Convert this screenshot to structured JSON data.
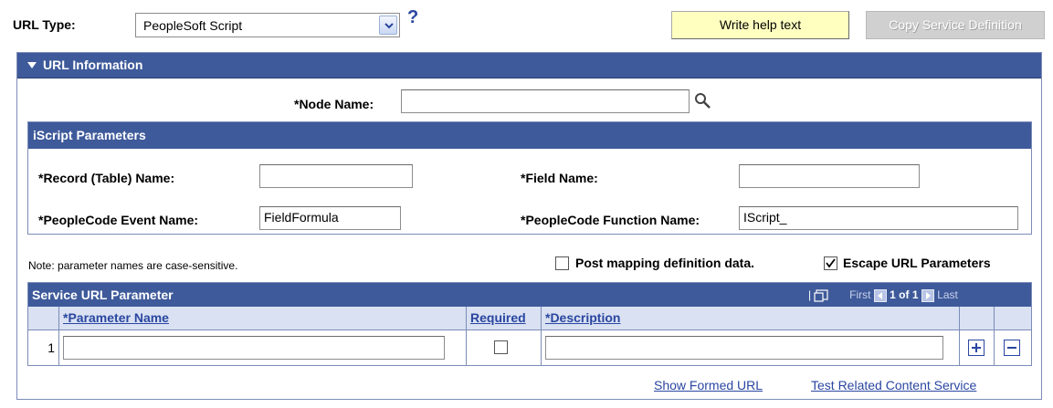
{
  "top": {
    "url_type_label": "URL Type:",
    "url_type_value": "PeopleSoft Script",
    "help_mark": "?",
    "write_help_label": "Write help text",
    "copy_service_label": "Copy Service Definition"
  },
  "url_info": {
    "title": "URL Information",
    "node_name_label": "*Node Name:",
    "node_name_value": ""
  },
  "iscript": {
    "title": "iScript Parameters",
    "record_label": "*Record (Table) Name:",
    "record_value": "",
    "field_label": "*Field Name:",
    "field_value": "",
    "event_label": "*PeopleCode Event Name:",
    "event_value": "FieldFormula",
    "function_label": "*PeopleCode Function Name:",
    "function_value": "IScript_"
  },
  "options": {
    "note": "Note: parameter names are case-sensitive.",
    "post_mapping_label": "Post mapping definition data.",
    "post_mapping_checked": false,
    "escape_label": "Escape URL Parameters",
    "escape_checked": true
  },
  "grid": {
    "title": "Service URL Parameter",
    "nav_first": "First",
    "nav_count": "1 of 1",
    "nav_last": "Last",
    "columns": [
      "*Parameter Name",
      "Required",
      "*Description"
    ],
    "rows": [
      {
        "num": "1",
        "parameter_name": "",
        "required": false,
        "description": ""
      }
    ]
  },
  "footer": {
    "show_formed_url": "Show Formed URL",
    "test_service": "Test Related Content Service"
  },
  "colors": {
    "header_blue": "#3e5a9a",
    "link_blue": "#2a46a0",
    "help_button_yellow": "#ffffc0"
  },
  "icons": [
    "chevron-down-icon",
    "help-icon",
    "collapse-triangle-icon",
    "search-icon",
    "view-all-icon",
    "first-arrow-icon",
    "last-arrow-icon",
    "add-row-icon",
    "delete-row-icon",
    "checkmark-icon"
  ]
}
